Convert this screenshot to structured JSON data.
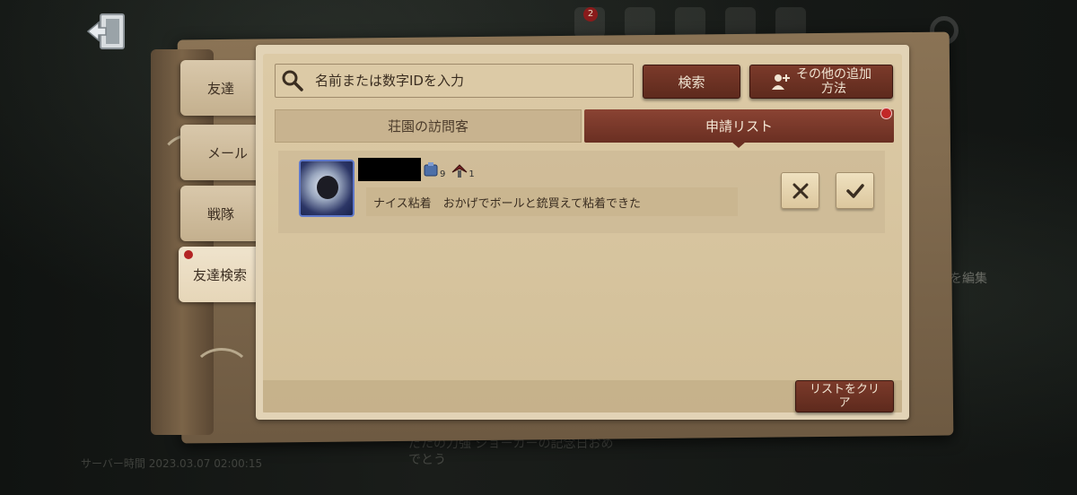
{
  "background": {
    "server_time": "サーバー時間 2023.03.07 02:00:15",
    "message_preview": "だたの力強 ジョーカーの記念日おめ\nでとう",
    "edit_label": "を編集",
    "notification_count": "2"
  },
  "tabs_side": {
    "friends": "友達",
    "mail": "メール",
    "squad": "戦隊",
    "friend_search": "友達検索"
  },
  "search": {
    "placeholder": "名前または数字IDを入力",
    "search_button": "検索",
    "add_method_button": "その他の追加\n方法"
  },
  "list_tabs": {
    "visitors": "荘園の訪問客",
    "requests": "申請リスト"
  },
  "request": {
    "message": "ナイス粘着　おかげでボールと銃買えて粘着できた",
    "badge_1_count": "9",
    "badge_2_count": "1"
  },
  "footer": {
    "clear_list_button": "リストをクリ\nア"
  },
  "colors": {
    "accent_red": "#6a2f22",
    "paper": "#dccaa6",
    "notification_dot": "#c22828"
  }
}
